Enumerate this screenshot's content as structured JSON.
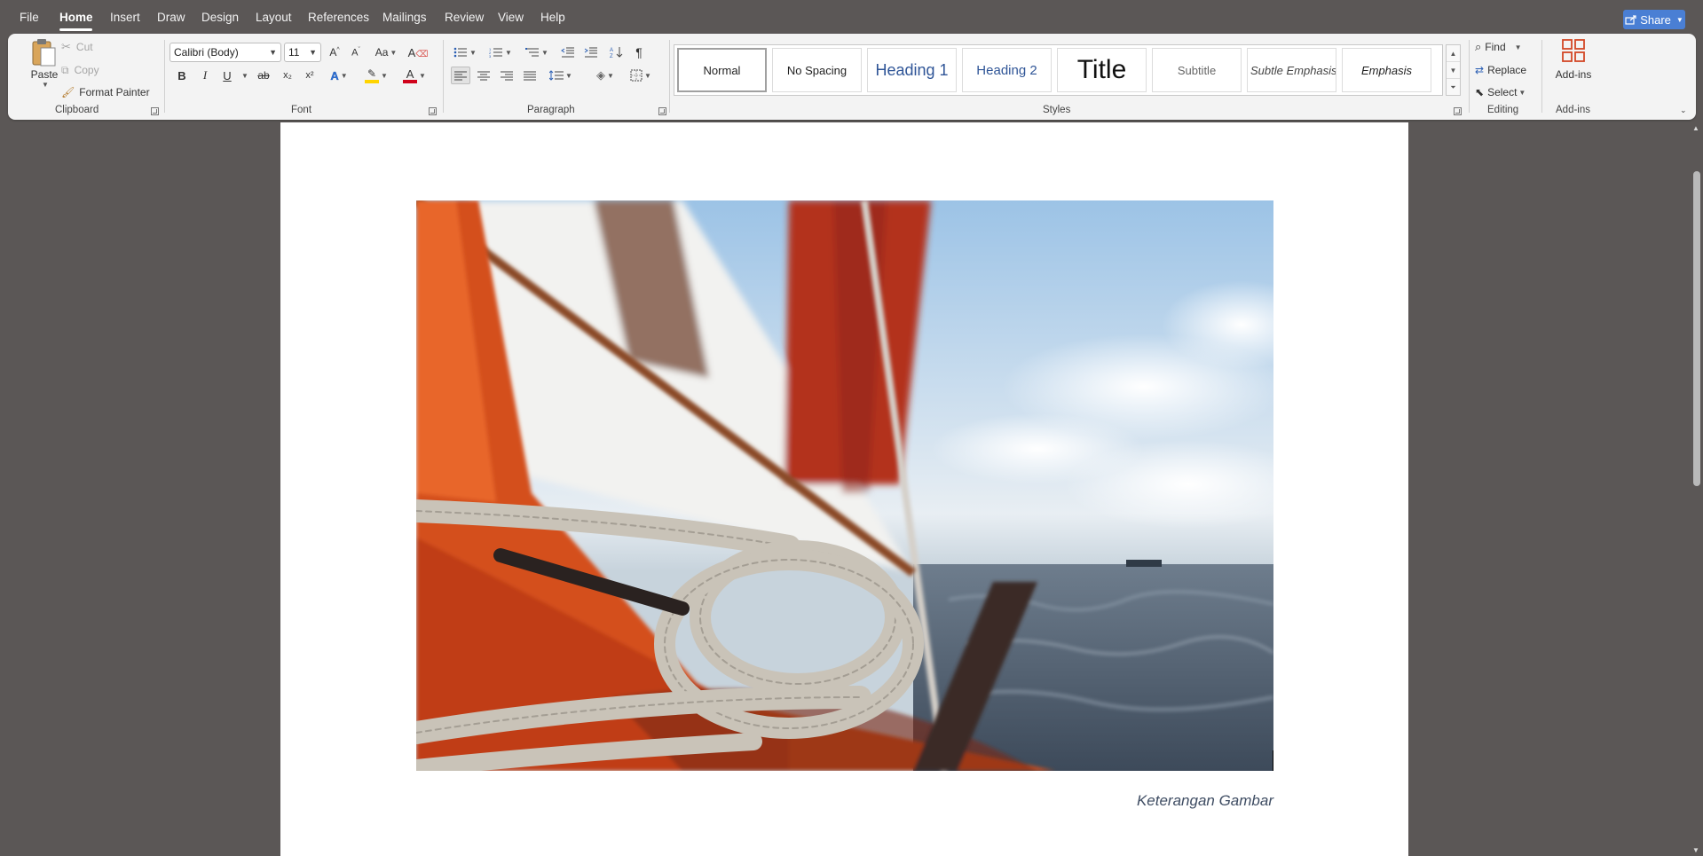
{
  "menu": {
    "items": [
      "File",
      "Home",
      "Insert",
      "Draw",
      "Design",
      "Layout",
      "References",
      "Mailings",
      "Review",
      "View",
      "Help"
    ],
    "active": "Home",
    "share_label": "Share"
  },
  "clipboard": {
    "paste": "Paste",
    "cut": "Cut",
    "copy": "Copy",
    "format_painter": "Format Painter",
    "group_label": "Clipboard"
  },
  "font": {
    "name": "Calibri (Body)",
    "size": "11",
    "group_label": "Font",
    "change_case": "Aa",
    "bold": "B",
    "italic": "I",
    "underline": "U",
    "strike": "ab",
    "subscript": "x₂",
    "superscript": "x²",
    "text_effects": "A",
    "font_color": "A",
    "highlight_color": "#ffd400",
    "font_color_value": "#d0021b"
  },
  "paragraph": {
    "group_label": "Paragraph",
    "pilcrow": "¶"
  },
  "styles": {
    "group_label": "Styles",
    "items": [
      "Normal",
      "No Spacing",
      "Heading 1",
      "Heading 2",
      "Title",
      "Subtitle",
      "Subtle Emphasis",
      "Emphasis"
    ],
    "selected": "Normal"
  },
  "editing": {
    "find": "Find",
    "replace": "Replace",
    "select": "Select",
    "group_label": "Editing"
  },
  "addins": {
    "label": "Add-ins",
    "group_label": "Add-ins"
  },
  "document": {
    "caption": "Keterangan Gambar"
  },
  "colors": {
    "accent": "#4a7fd4",
    "heading_blue": "#2f5597"
  }
}
